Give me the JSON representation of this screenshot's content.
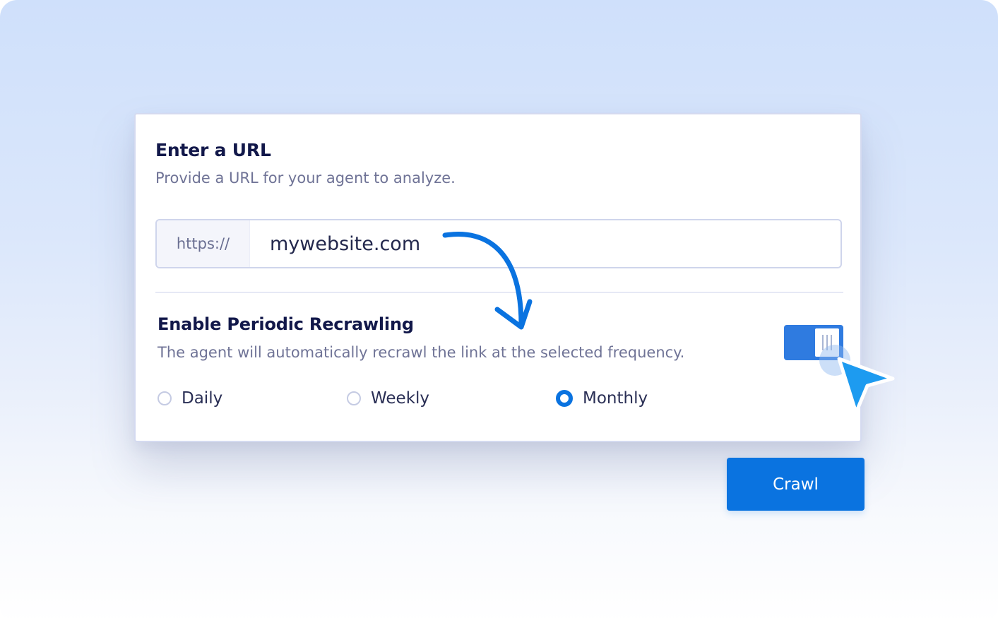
{
  "url_section": {
    "title": "Enter a URL",
    "subtitle": "Provide a URL for your agent to analyze.",
    "prefix": "https://",
    "value": "mywebsite.com"
  },
  "recrawl_section": {
    "title": "Enable Periodic Recrawling",
    "description": "The agent will automatically recrawl the link at the selected frequency.",
    "toggle_enabled": true,
    "options": [
      {
        "label": "Daily",
        "selected": false
      },
      {
        "label": "Weekly",
        "selected": false
      },
      {
        "label": "Monthly",
        "selected": true
      }
    ]
  },
  "actions": {
    "crawl_label": "Crawl"
  },
  "colors": {
    "accent": "#0a73e0",
    "toggle": "#2f7be0",
    "heading": "#12184a",
    "muted": "#6f7396"
  },
  "icons": {
    "annotation_arrow": "curved-arrow-icon",
    "pointer": "cursor-pointer-icon"
  }
}
